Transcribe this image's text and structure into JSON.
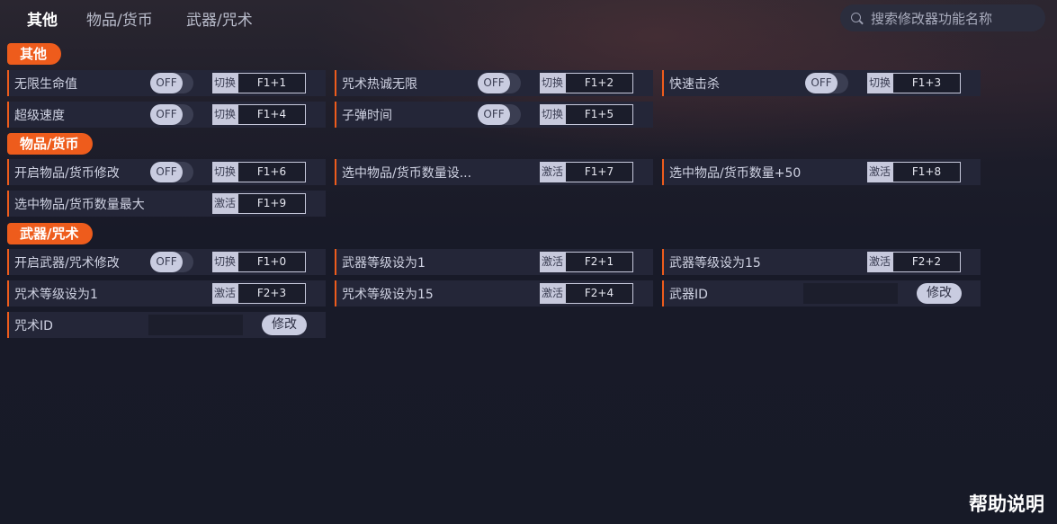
{
  "tabs": [
    "其他",
    "物品/货币",
    "武器/咒术"
  ],
  "search": {
    "placeholder": "搜索修改器功能名称"
  },
  "sections": [
    "其他",
    "物品/货币",
    "武器/咒术"
  ],
  "common": {
    "toggle_off": "OFF",
    "switch_label": "切换",
    "activate_label": "激活",
    "modify_label": "修改"
  },
  "items": {
    "infinite_health": {
      "label": "无限生命值",
      "key": "F1+1"
    },
    "spell_heat": {
      "label": "咒术热诚无限",
      "key": "F1+2"
    },
    "quick_kill": {
      "label": "快速击杀",
      "key": "F1+3"
    },
    "super_speed": {
      "label": "超级速度",
      "key": "F1+4"
    },
    "bullet_time": {
      "label": "子弹时间",
      "key": "F1+5"
    },
    "enable_item_mod": {
      "label": "开启物品/货币修改",
      "key": "F1+6"
    },
    "set_item_qty": {
      "label": "选中物品/货币数量设...",
      "key": "F1+7"
    },
    "item_qty_plus50": {
      "label": "选中物品/货币数量+50",
      "key": "F1+8"
    },
    "item_qty_max": {
      "label": "选中物品/货币数量最大",
      "key": "F1+9"
    },
    "enable_weapon_mod": {
      "label": "开启武器/咒术修改",
      "key": "F1+0"
    },
    "weapon_level_1": {
      "label": "武器等级设为1",
      "key": "F2+1"
    },
    "weapon_level_15": {
      "label": "武器等级设为15",
      "key": "F2+2"
    },
    "spell_level_1": {
      "label": "咒术等级设为1",
      "key": "F2+3"
    },
    "spell_level_15": {
      "label": "咒术等级设为15",
      "key": "F2+4"
    },
    "weapon_id": {
      "label": "武器ID",
      "value": ""
    },
    "spell_id": {
      "label": "咒术ID",
      "value": ""
    }
  },
  "help_label": "帮助说明",
  "colors": {
    "accent": "#ee5c1c",
    "row_bg": "#242638",
    "page_bg": "#171a27"
  }
}
